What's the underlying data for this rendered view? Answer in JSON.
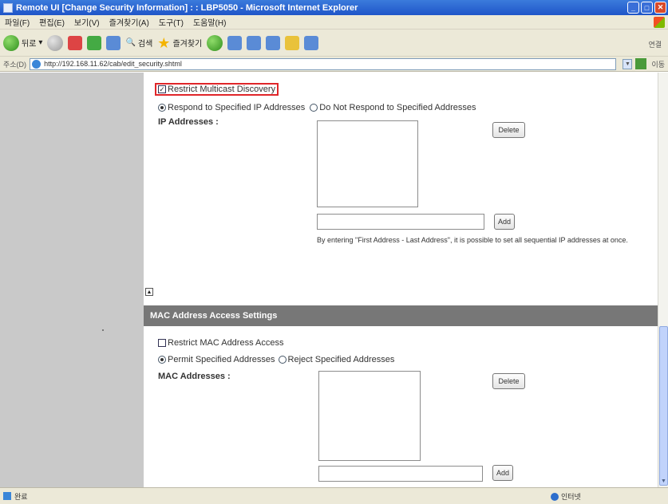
{
  "window": {
    "title": "Remote UI [Change Security Information] : : LBP5050 - Microsoft Internet Explorer"
  },
  "menubar": {
    "items": [
      "파일(F)",
      "편집(E)",
      "보기(V)",
      "즐겨찾기(A)",
      "도구(T)",
      "도움말(H)"
    ]
  },
  "toolbar": {
    "back_label": "뒤로",
    "search_label": "검색",
    "favorites_label": "즐겨찾기",
    "right_label": "연결"
  },
  "address": {
    "label": "주소(D)",
    "url": "http://192.168.11.62/cab/edit_security.shtml",
    "go_label": "이동"
  },
  "multicast": {
    "restrict_label": "Restrict Multicast Discovery",
    "restrict_checked": true,
    "respond_label": "Respond to Specified IP Addresses",
    "no_respond_label": "Do Not Respond to Specified Addresses",
    "ip_label": "IP Addresses :",
    "delete_label": "Delete",
    "add_label": "Add",
    "note": "By entering \"First Address - Last Address\", it is possible to set all sequential IP addresses at once."
  },
  "mac": {
    "section_title": "MAC Address Access Settings",
    "restrict_label": "Restrict MAC Address Access",
    "restrict_checked": false,
    "permit_label": "Permit Specified Addresses",
    "reject_label": "Reject Specified Addresses",
    "mac_label": "MAC Addresses :",
    "delete_label": "Delete",
    "add_label": "Add"
  },
  "status": {
    "left": "완료",
    "zone": "인터넷"
  }
}
